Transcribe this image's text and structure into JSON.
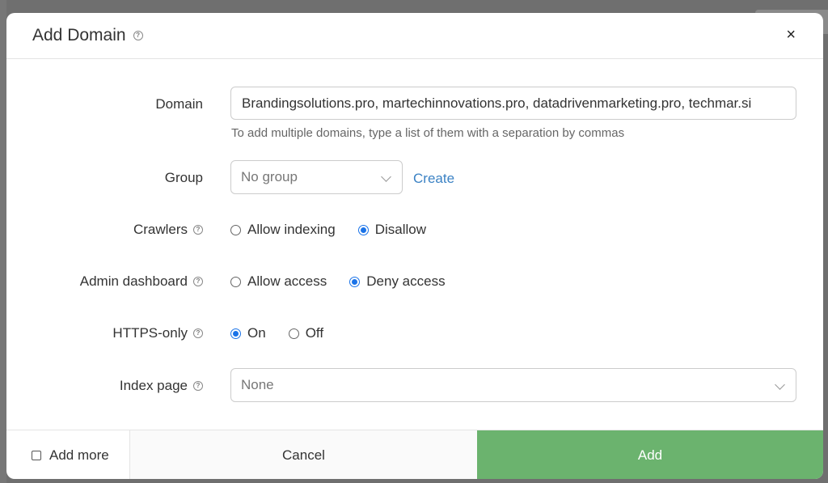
{
  "dialog": {
    "title": "Add Domain",
    "close_label": "×"
  },
  "form": {
    "domain": {
      "label": "Domain",
      "value": "Brandingsolutions.pro, martechinnovations.pro, datadrivenmarketing.pro, techmar.si",
      "hint": "To add multiple domains, type a list of them with a separation by commas"
    },
    "group": {
      "label": "Group",
      "selected": "No group",
      "create_label": "Create"
    },
    "crawlers": {
      "label": "Crawlers",
      "options": [
        {
          "label": "Allow indexing",
          "checked": false
        },
        {
          "label": "Disallow",
          "checked": true
        }
      ]
    },
    "admin_dashboard": {
      "label": "Admin dashboard",
      "options": [
        {
          "label": "Allow access",
          "checked": false
        },
        {
          "label": "Deny access",
          "checked": true
        }
      ]
    },
    "https_only": {
      "label": "HTTPS-only",
      "options": [
        {
          "label": "On",
          "checked": true
        },
        {
          "label": "Off",
          "checked": false
        }
      ]
    },
    "index_page": {
      "label": "Index page",
      "selected": "None"
    }
  },
  "footer": {
    "add_more_label": "Add more",
    "cancel_label": "Cancel",
    "add_label": "Add"
  },
  "colors": {
    "accent": "#1a73e8",
    "link": "#3b82c4",
    "add_button": "#6bb36e"
  },
  "icons": {
    "help": "question-circle-icon",
    "close": "close-icon",
    "dropdown": "chevron-down-icon"
  }
}
